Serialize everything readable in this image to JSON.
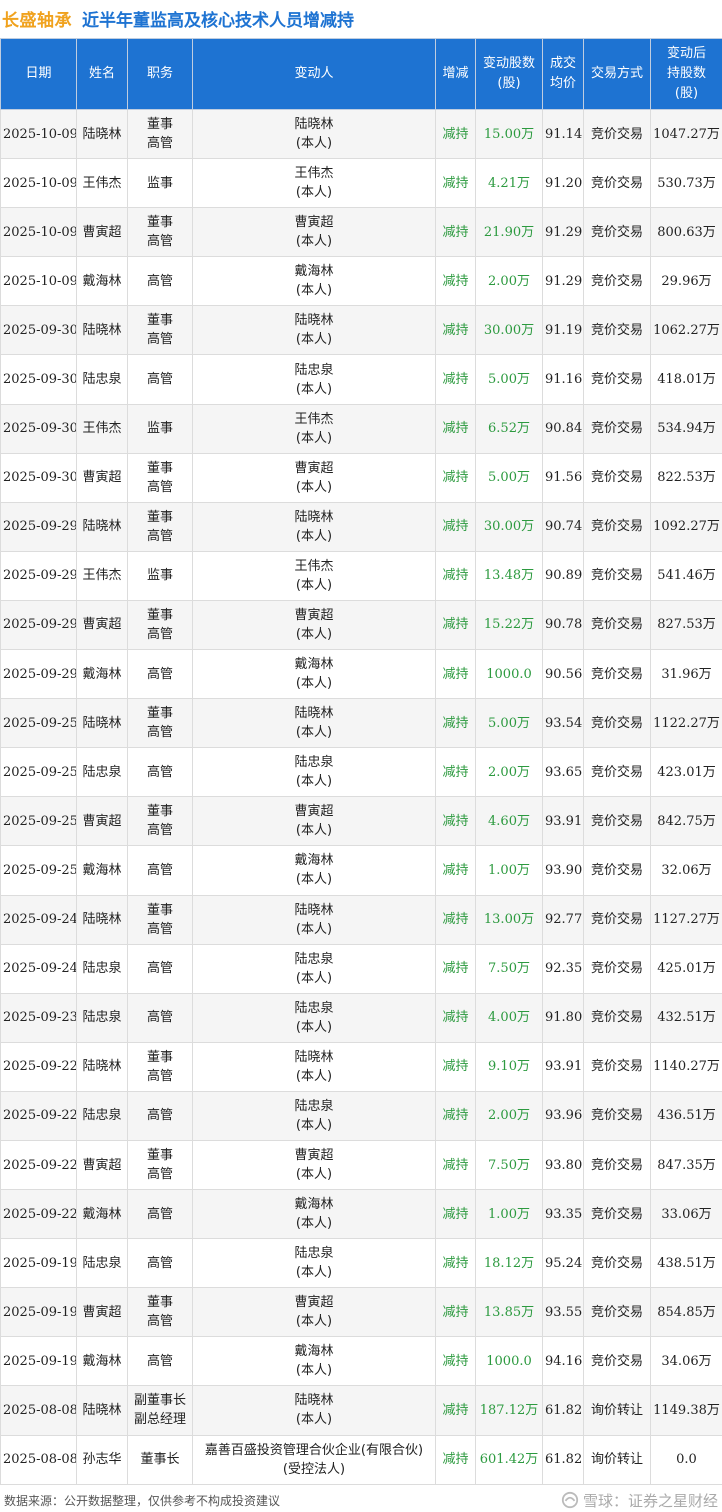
{
  "title": {
    "company": "长盛轴承",
    "text": "近半年董监高及核心技术人员增减持"
  },
  "headers": [
    "日期",
    "姓名",
    "职务",
    "变动人",
    "增减",
    "变动股数\n(股)",
    "成交\n均价",
    "交易方式",
    "变动后\n持股数\n(股)"
  ],
  "rows": [
    {
      "date": "2025-10-09",
      "name": "陆晓林",
      "title": [
        "董事",
        "高管"
      ],
      "person": [
        "陆晓林",
        "(本人)"
      ],
      "type": "减持",
      "change": "15.00万",
      "price": "91.14",
      "method": "竞价交易",
      "after": "1047.27万"
    },
    {
      "date": "2025-10-09",
      "name": "王伟杰",
      "title": [
        "监事"
      ],
      "person": [
        "王伟杰",
        "(本人)"
      ],
      "type": "减持",
      "change": "4.21万",
      "price": "91.20",
      "method": "竞价交易",
      "after": "530.73万"
    },
    {
      "date": "2025-10-09",
      "name": "曹寅超",
      "title": [
        "董事",
        "高管"
      ],
      "person": [
        "曹寅超",
        "(本人)"
      ],
      "type": "减持",
      "change": "21.90万",
      "price": "91.29",
      "method": "竞价交易",
      "after": "800.63万"
    },
    {
      "date": "2025-10-09",
      "name": "戴海林",
      "title": [
        "高管"
      ],
      "person": [
        "戴海林",
        "(本人)"
      ],
      "type": "减持",
      "change": "2.00万",
      "price": "91.29",
      "method": "竞价交易",
      "after": "29.96万"
    },
    {
      "date": "2025-09-30",
      "name": "陆晓林",
      "title": [
        "董事",
        "高管"
      ],
      "person": [
        "陆晓林",
        "(本人)"
      ],
      "type": "减持",
      "change": "30.00万",
      "price": "91.19",
      "method": "竞价交易",
      "after": "1062.27万"
    },
    {
      "date": "2025-09-30",
      "name": "陆忠泉",
      "title": [
        "高管"
      ],
      "person": [
        "陆忠泉",
        "(本人)"
      ],
      "type": "减持",
      "change": "5.00万",
      "price": "91.16",
      "method": "竞价交易",
      "after": "418.01万"
    },
    {
      "date": "2025-09-30",
      "name": "王伟杰",
      "title": [
        "监事"
      ],
      "person": [
        "王伟杰",
        "(本人)"
      ],
      "type": "减持",
      "change": "6.52万",
      "price": "90.84",
      "method": "竞价交易",
      "after": "534.94万"
    },
    {
      "date": "2025-09-30",
      "name": "曹寅超",
      "title": [
        "董事",
        "高管"
      ],
      "person": [
        "曹寅超",
        "(本人)"
      ],
      "type": "减持",
      "change": "5.00万",
      "price": "91.56",
      "method": "竞价交易",
      "after": "822.53万"
    },
    {
      "date": "2025-09-29",
      "name": "陆晓林",
      "title": [
        "董事",
        "高管"
      ],
      "person": [
        "陆晓林",
        "(本人)"
      ],
      "type": "减持",
      "change": "30.00万",
      "price": "90.74",
      "method": "竞价交易",
      "after": "1092.27万"
    },
    {
      "date": "2025-09-29",
      "name": "王伟杰",
      "title": [
        "监事"
      ],
      "person": [
        "王伟杰",
        "(本人)"
      ],
      "type": "减持",
      "change": "13.48万",
      "price": "90.89",
      "method": "竞价交易",
      "after": "541.46万"
    },
    {
      "date": "2025-09-29",
      "name": "曹寅超",
      "title": [
        "董事",
        "高管"
      ],
      "person": [
        "曹寅超",
        "(本人)"
      ],
      "type": "减持",
      "change": "15.22万",
      "price": "90.78",
      "method": "竞价交易",
      "after": "827.53万"
    },
    {
      "date": "2025-09-29",
      "name": "戴海林",
      "title": [
        "高管"
      ],
      "person": [
        "戴海林",
        "(本人)"
      ],
      "type": "减持",
      "change": "1000.0",
      "price": "90.56",
      "method": "竞价交易",
      "after": "31.96万"
    },
    {
      "date": "2025-09-25",
      "name": "陆晓林",
      "title": [
        "董事",
        "高管"
      ],
      "person": [
        "陆晓林",
        "(本人)"
      ],
      "type": "减持",
      "change": "5.00万",
      "price": "93.54",
      "method": "竞价交易",
      "after": "1122.27万"
    },
    {
      "date": "2025-09-25",
      "name": "陆忠泉",
      "title": [
        "高管"
      ],
      "person": [
        "陆忠泉",
        "(本人)"
      ],
      "type": "减持",
      "change": "2.00万",
      "price": "93.65",
      "method": "竞价交易",
      "after": "423.01万"
    },
    {
      "date": "2025-09-25",
      "name": "曹寅超",
      "title": [
        "董事",
        "高管"
      ],
      "person": [
        "曹寅超",
        "(本人)"
      ],
      "type": "减持",
      "change": "4.60万",
      "price": "93.91",
      "method": "竞价交易",
      "after": "842.75万"
    },
    {
      "date": "2025-09-25",
      "name": "戴海林",
      "title": [
        "高管"
      ],
      "person": [
        "戴海林",
        "(本人)"
      ],
      "type": "减持",
      "change": "1.00万",
      "price": "93.90",
      "method": "竞价交易",
      "after": "32.06万"
    },
    {
      "date": "2025-09-24",
      "name": "陆晓林",
      "title": [
        "董事",
        "高管"
      ],
      "person": [
        "陆晓林",
        "(本人)"
      ],
      "type": "减持",
      "change": "13.00万",
      "price": "92.77",
      "method": "竞价交易",
      "after": "1127.27万"
    },
    {
      "date": "2025-09-24",
      "name": "陆忠泉",
      "title": [
        "高管"
      ],
      "person": [
        "陆忠泉",
        "(本人)"
      ],
      "type": "减持",
      "change": "7.50万",
      "price": "92.35",
      "method": "竞价交易",
      "after": "425.01万"
    },
    {
      "date": "2025-09-23",
      "name": "陆忠泉",
      "title": [
        "高管"
      ],
      "person": [
        "陆忠泉",
        "(本人)"
      ],
      "type": "减持",
      "change": "4.00万",
      "price": "91.80",
      "method": "竞价交易",
      "after": "432.51万"
    },
    {
      "date": "2025-09-22",
      "name": "陆晓林",
      "title": [
        "董事",
        "高管"
      ],
      "person": [
        "陆晓林",
        "(本人)"
      ],
      "type": "减持",
      "change": "9.10万",
      "price": "93.91",
      "method": "竞价交易",
      "after": "1140.27万"
    },
    {
      "date": "2025-09-22",
      "name": "陆忠泉",
      "title": [
        "高管"
      ],
      "person": [
        "陆忠泉",
        "(本人)"
      ],
      "type": "减持",
      "change": "2.00万",
      "price": "93.96",
      "method": "竞价交易",
      "after": "436.51万"
    },
    {
      "date": "2025-09-22",
      "name": "曹寅超",
      "title": [
        "董事",
        "高管"
      ],
      "person": [
        "曹寅超",
        "(本人)"
      ],
      "type": "减持",
      "change": "7.50万",
      "price": "93.80",
      "method": "竞价交易",
      "after": "847.35万"
    },
    {
      "date": "2025-09-22",
      "name": "戴海林",
      "title": [
        "高管"
      ],
      "person": [
        "戴海林",
        "(本人)"
      ],
      "type": "减持",
      "change": "1.00万",
      "price": "93.35",
      "method": "竞价交易",
      "after": "33.06万"
    },
    {
      "date": "2025-09-19",
      "name": "陆忠泉",
      "title": [
        "高管"
      ],
      "person": [
        "陆忠泉",
        "(本人)"
      ],
      "type": "减持",
      "change": "18.12万",
      "price": "95.24",
      "method": "竞价交易",
      "after": "438.51万"
    },
    {
      "date": "2025-09-19",
      "name": "曹寅超",
      "title": [
        "董事",
        "高管"
      ],
      "person": [
        "曹寅超",
        "(本人)"
      ],
      "type": "减持",
      "change": "13.85万",
      "price": "93.55",
      "method": "竞价交易",
      "after": "854.85万"
    },
    {
      "date": "2025-09-19",
      "name": "戴海林",
      "title": [
        "高管"
      ],
      "person": [
        "戴海林",
        "(本人)"
      ],
      "type": "减持",
      "change": "1000.0",
      "price": "94.16",
      "method": "竞价交易",
      "after": "34.06万"
    },
    {
      "date": "2025-08-08",
      "name": "陆晓林",
      "title": [
        "副董事长",
        "副总经理"
      ],
      "person": [
        "陆晓林",
        "(本人)"
      ],
      "type": "减持",
      "change": "187.12万",
      "price": "61.82",
      "method": "询价转让",
      "after": "1149.38万"
    },
    {
      "date": "2025-08-08",
      "name": "孙志华",
      "title": [
        "董事长"
      ],
      "person": [
        "嘉善百盛投资管理合伙企业(有限合伙)",
        "(受控法人)"
      ],
      "type": "减持",
      "change": "601.42万",
      "price": "61.82",
      "method": "询价转让",
      "after": "0.0"
    }
  ],
  "footer": {
    "source": "数据来源：公开数据整理，仅供参考不构成投资建议",
    "brand": "雪球：证券之星财经"
  },
  "colors": {
    "header_bg": "#1e73d2",
    "company": "#f0a21e",
    "title": "#1e73d2",
    "decrease": "#2c9a3f"
  }
}
